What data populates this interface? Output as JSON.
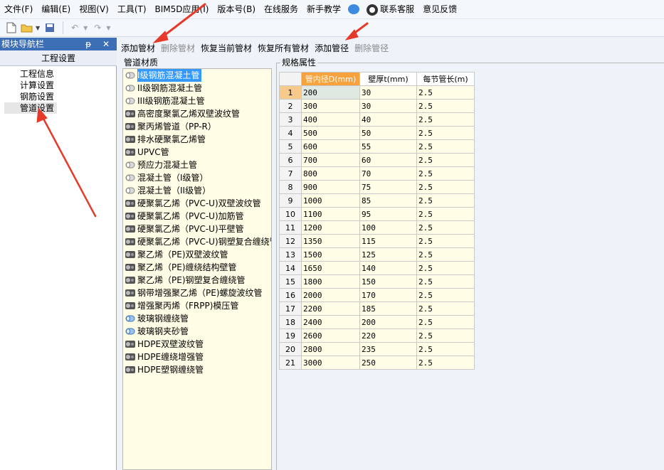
{
  "menu": [
    "文件(F)",
    "编辑(E)",
    "视图(V)",
    "工具(T)",
    "BIM5D应用(I)",
    "版本号(B)",
    "在线服务",
    "新手教学",
    "联系客服",
    "意见反馈"
  ],
  "nav": {
    "header": "模块导航栏",
    "controls": "ᵽ ✕",
    "tab": "工程设置",
    "items": [
      "工程信息",
      "计算设置",
      "钢筋设置",
      "管道设置"
    ]
  },
  "actions": [
    {
      "label": "添加管材",
      "enabled": true
    },
    {
      "label": "删除管材",
      "enabled": false
    },
    {
      "label": "恢复当前管材",
      "enabled": true
    },
    {
      "label": "恢复所有管材",
      "enabled": true
    },
    {
      "label": "添加管径",
      "enabled": true
    },
    {
      "label": "删除管径",
      "enabled": false
    }
  ],
  "materials": {
    "title": "管道材质",
    "items": [
      {
        "label": "I级钢筋混凝土管",
        "icon": "round"
      },
      {
        "label": "II级钢筋混凝土管",
        "icon": "round"
      },
      {
        "label": "III级钢筋混凝土管",
        "icon": "round"
      },
      {
        "label": "高密度聚氯乙烯双壁波纹管",
        "icon": "dark"
      },
      {
        "label": "聚丙烯管道（PP-R）",
        "icon": "dark"
      },
      {
        "label": "排水硬聚氯乙烯管",
        "icon": "dark"
      },
      {
        "label": "UPVC管",
        "icon": "dark"
      },
      {
        "label": "预应力混凝土管",
        "icon": "round"
      },
      {
        "label": "混凝土管（I级管）",
        "icon": "round"
      },
      {
        "label": "混凝土管（II级管）",
        "icon": "round"
      },
      {
        "label": "硬聚氯乙烯（PVC-U)双壁波纹管",
        "icon": "dark"
      },
      {
        "label": "硬聚氯乙烯（PVC-U)加筋管",
        "icon": "dark"
      },
      {
        "label": "硬聚氯乙烯（PVC-U)平壁管",
        "icon": "dark"
      },
      {
        "label": "硬聚氯乙烯（PVC-U)钢塑复合缠绕管",
        "icon": "dark"
      },
      {
        "label": "聚乙烯（PE)双壁波纹管",
        "icon": "dark"
      },
      {
        "label": "聚乙烯（PE)缠绕结构壁管",
        "icon": "dark"
      },
      {
        "label": "聚乙烯（PE)钢塑复合缠绕管",
        "icon": "dark"
      },
      {
        "label": "钢带增强聚乙烯（PE)螺旋波纹管",
        "icon": "dark"
      },
      {
        "label": "增强聚丙烯（FRPP)模压管",
        "icon": "dark"
      },
      {
        "label": "玻璃钢缠绕管",
        "icon": "blue"
      },
      {
        "label": "玻璃钢夹砂管",
        "icon": "blue"
      },
      {
        "label": "HDPE双壁波纹管",
        "icon": "dark"
      },
      {
        "label": "HDPE缠绕增强管",
        "icon": "dark"
      },
      {
        "label": "HDPE塑钢缠绕管",
        "icon": "dark"
      }
    ]
  },
  "spec": {
    "title": "规格属性",
    "headers": [
      "管内径D(mm)",
      "壁厚t(mm)",
      "每节管长(m)"
    ],
    "rows": [
      [
        "1",
        "200",
        "30",
        "2.5"
      ],
      [
        "2",
        "300",
        "30",
        "2.5"
      ],
      [
        "3",
        "400",
        "40",
        "2.5"
      ],
      [
        "4",
        "500",
        "50",
        "2.5"
      ],
      [
        "5",
        "600",
        "55",
        "2.5"
      ],
      [
        "6",
        "700",
        "60",
        "2.5"
      ],
      [
        "7",
        "800",
        "70",
        "2.5"
      ],
      [
        "8",
        "900",
        "75",
        "2.5"
      ],
      [
        "9",
        "1000",
        "85",
        "2.5"
      ],
      [
        "10",
        "1100",
        "95",
        "2.5"
      ],
      [
        "11",
        "1200",
        "100",
        "2.5"
      ],
      [
        "12",
        "1350",
        "115",
        "2.5"
      ],
      [
        "13",
        "1500",
        "125",
        "2.5"
      ],
      [
        "14",
        "1650",
        "140",
        "2.5"
      ],
      [
        "15",
        "1800",
        "150",
        "2.5"
      ],
      [
        "16",
        "2000",
        "170",
        "2.5"
      ],
      [
        "17",
        "2200",
        "185",
        "2.5"
      ],
      [
        "18",
        "2400",
        "200",
        "2.5"
      ],
      [
        "19",
        "2600",
        "220",
        "2.5"
      ],
      [
        "20",
        "2800",
        "235",
        "2.5"
      ],
      [
        "21",
        "3000",
        "250",
        "2.5"
      ]
    ]
  },
  "colors": {
    "nav_header": "#3d6fb6",
    "selected": "#3399ff",
    "arrow": "#e53a2a",
    "header_active": "#f7a23c"
  }
}
